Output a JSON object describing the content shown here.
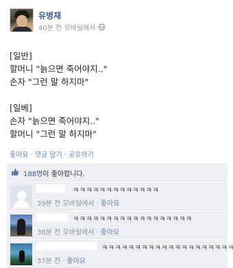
{
  "post": {
    "author": "유병재",
    "time": "40분 전 모바일에서",
    "body_lines": [
      "[일반]",
      "할머니 \"늙으면 죽어야지..\"",
      "손자 \"그런 말 하지마\"",
      "",
      "[일베]",
      "손자 \"늙으면 죽어야지..\"",
      "할머니 \"그런 말 하지마\""
    ]
  },
  "actions": {
    "like": "좋아요",
    "comment": "댓글 달기",
    "share": "공유하기",
    "separator": "·"
  },
  "likes": {
    "count": "188명",
    "suffix": "이 좋아합니다."
  },
  "comments": [
    {
      "text": "ㅋㅋㅋㅋㅋㅋㅋㅋㅋㅋㅋㅋㅋ",
      "time": "39분 전 모바일에서",
      "like": "좋아요"
    },
    {
      "text": "ㅋㅋㅋㅋㅋㅋㅋㅋㅋㅋㅋㅋㅋㅋㅋㅋㅋㅋ",
      "time": "38분 전 모바일에서",
      "like": "좋아요"
    },
    {
      "text": "ㅋㅋㅋㅋㅋㅋㅋㅋㅋㅋㅋㅋㅋㅋㅋㅋㅋㅋㅋㅋㅋ",
      "time": "37분 전",
      "like": "좋아요"
    }
  ],
  "icons": {
    "globe": "globe-icon",
    "thumb": "thumbs-up-icon"
  },
  "colors": {
    "link": "#3b5998",
    "action": "#6d84b4",
    "meta": "#90949c",
    "panel": "#edeff4"
  }
}
